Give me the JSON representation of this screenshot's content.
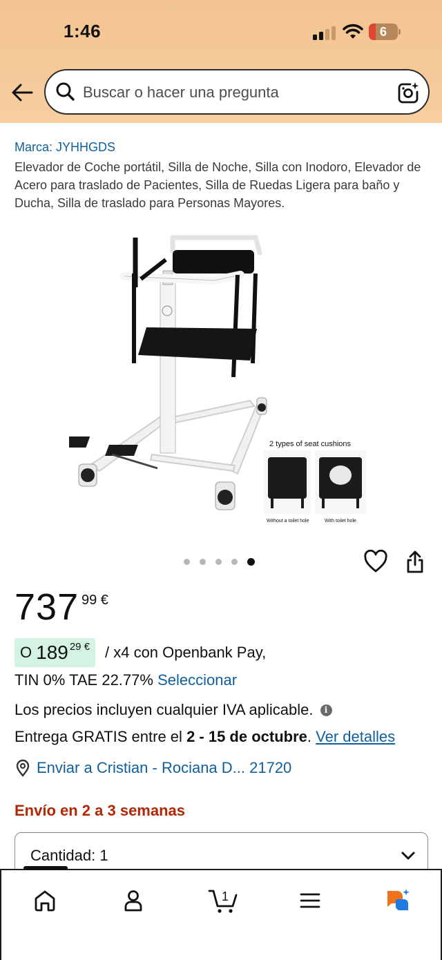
{
  "status_bar": {
    "time": "1:46",
    "battery": "6"
  },
  "search": {
    "placeholder": "Buscar o hacer una pregunta"
  },
  "product": {
    "brand": "Marca: JYHHGDS",
    "title": "Elevador de Coche portátil, Silla de Noche, Silla con Inodoro, Elevador de Acero para traslado de Pacientes, Silla de Ruedas Ligera para baño y Ducha, Silla de traslado para Personas Mayores.",
    "image_caption": "2 types of seat cushions",
    "cushion_labels": [
      "Without a toilet hole",
      "With toilet hole"
    ],
    "carousel": {
      "count": 5,
      "active_index": 4
    }
  },
  "price": {
    "whole": "737",
    "fraction": "99 €"
  },
  "installment": {
    "prefix": "O",
    "whole": "189",
    "fraction": "29 €",
    "rest": "/ x4 con Openbank Pay,",
    "tin_text": "TIN 0% TAE 22.77%",
    "select_link": "Seleccionar"
  },
  "iva_text": "Los precios incluyen cualquier IVA aplicable.",
  "delivery": {
    "prefix": "Entrega GRATIS entre el",
    "dates": "2 - 15 de octubre",
    "suffix": ".",
    "details_link": "Ver detalles"
  },
  "location": {
    "text": "Enviar a Cristian - Rociana D... 21720"
  },
  "shipping_time": "Envío en 2 a 3 semanas",
  "quantity": {
    "label": "Cantidad:",
    "value": "1"
  },
  "tabbar": {
    "cart_count": "1",
    "items": [
      "home-icon",
      "account-icon",
      "cart-icon",
      "menu-icon",
      "rufus-icon"
    ]
  },
  "colors": {
    "header_bg": "#f4c795",
    "link": "#0f5f9e",
    "installment_bg": "#d4f3e2",
    "shipping_red": "#b12704"
  }
}
